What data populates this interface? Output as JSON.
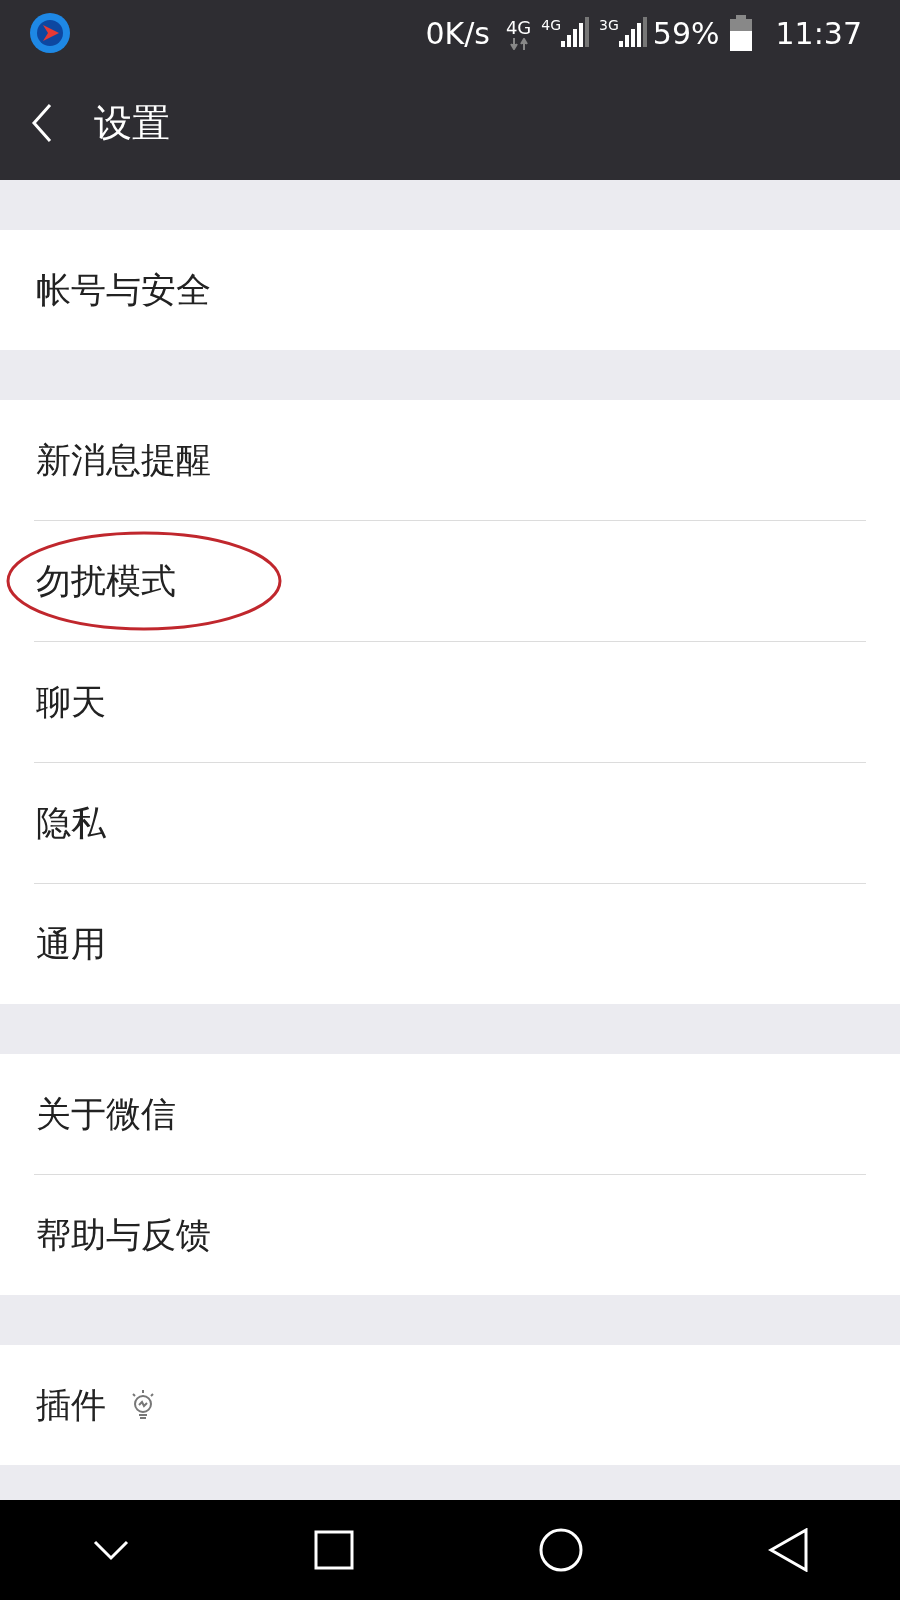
{
  "status_bar": {
    "speed": "0K/s",
    "data_network": "4G",
    "sim_1": "4G",
    "sim_2": "3G",
    "battery": "59%",
    "time": "11:37"
  },
  "header": {
    "title": "设置"
  },
  "groups": [
    {
      "items": [
        {
          "label": "帐号与安全",
          "kind": "plain",
          "circled": false
        }
      ]
    },
    {
      "items": [
        {
          "label": "新消息提醒",
          "kind": "plain",
          "circled": false
        },
        {
          "label": "勿扰模式",
          "kind": "plain",
          "circled": true
        },
        {
          "label": "聊天",
          "kind": "plain",
          "circled": false
        },
        {
          "label": "隐私",
          "kind": "plain",
          "circled": false
        },
        {
          "label": "通用",
          "kind": "plain",
          "circled": false
        }
      ]
    },
    {
      "items": [
        {
          "label": "关于微信",
          "kind": "plain",
          "circled": false
        },
        {
          "label": "帮助与反馈",
          "kind": "plain",
          "circled": false
        }
      ]
    },
    {
      "items": [
        {
          "label": "插件",
          "kind": "lightbulb",
          "circled": false
        }
      ]
    }
  ]
}
